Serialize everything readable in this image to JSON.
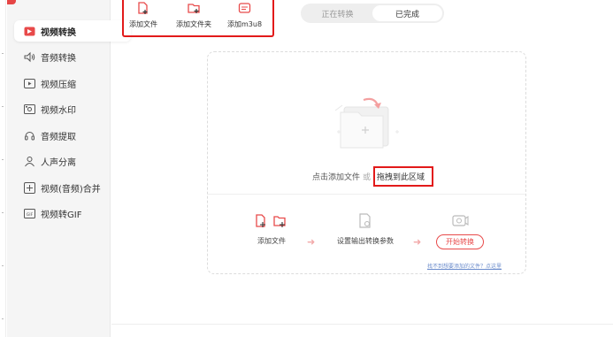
{
  "sidebar": {
    "items": [
      {
        "label": "视频转换",
        "icon": "video-convert-icon",
        "active": true
      },
      {
        "label": "音频转换",
        "icon": "audio-convert-icon"
      },
      {
        "label": "视频压缩",
        "icon": "video-compress-icon"
      },
      {
        "label": "视频水印",
        "icon": "watermark-icon"
      },
      {
        "label": "音频提取",
        "icon": "audio-extract-icon"
      },
      {
        "label": "人声分离",
        "icon": "vocal-separate-icon"
      },
      {
        "label": "视频(音频)合并",
        "icon": "merge-icon"
      },
      {
        "label": "视频转GIF",
        "icon": "gif-icon"
      }
    ]
  },
  "toolbar": {
    "add_file": "添加文件",
    "add_folder": "添加文件夹",
    "add_m3u8": "添加m3u8"
  },
  "tabs": {
    "converting": "正在转换",
    "completed": "已完成"
  },
  "drop": {
    "hint": "点击添加文件",
    "or": "或",
    "drag": "拖拽到此区域"
  },
  "steps": {
    "add_file": "添加文件",
    "set_params": "设置输出转换参数",
    "start": "开始转换"
  },
  "help_link": "找不到想要添加的文件？点这里",
  "colors": {
    "accent": "#e84a4a",
    "highlight_box": "#e21a1a"
  }
}
